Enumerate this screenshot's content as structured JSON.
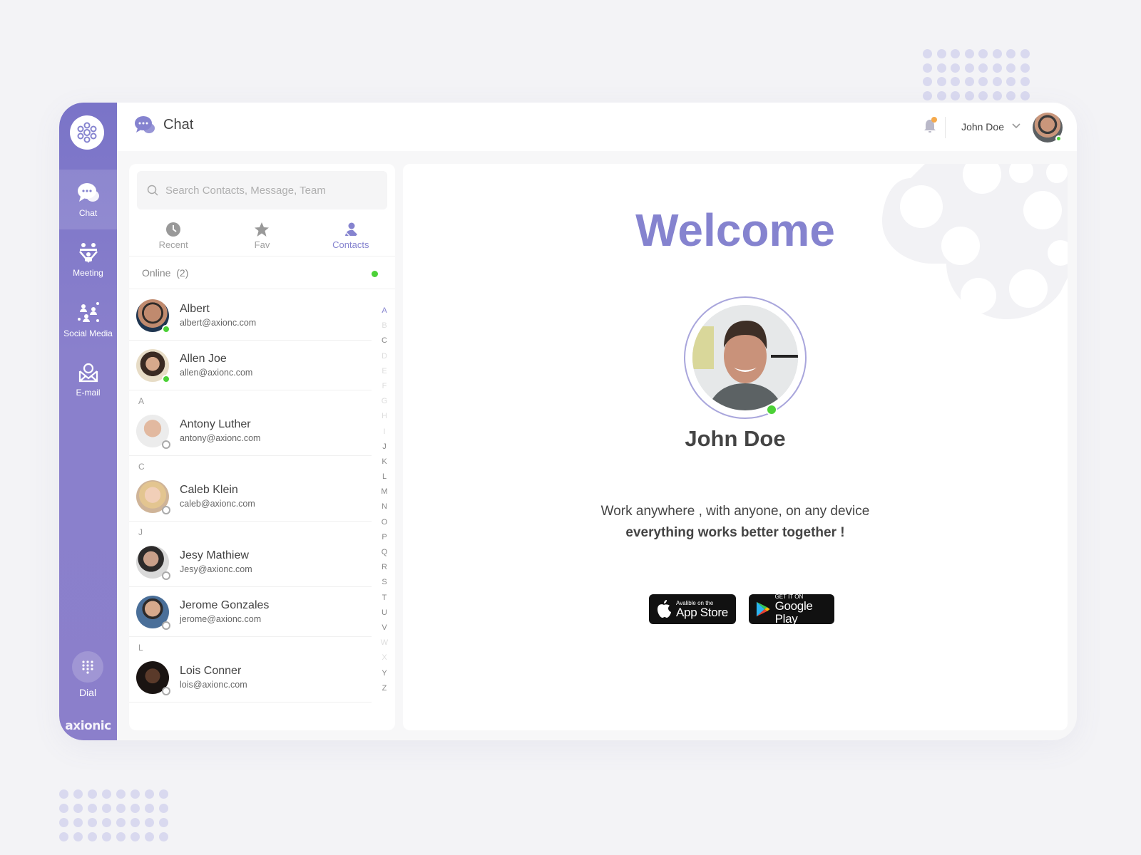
{
  "sidebar": {
    "items": [
      {
        "label": "Chat",
        "icon": "chat-bubbles-icon",
        "active": true
      },
      {
        "label": "Meeting",
        "icon": "meeting-icon",
        "active": false
      },
      {
        "label": "Social Media",
        "icon": "social-network-icon",
        "active": false
      },
      {
        "label": "E-mail",
        "icon": "email-icon",
        "active": false
      }
    ],
    "dial_label": "Dial",
    "brand": "axionic"
  },
  "header": {
    "title": "Chat",
    "user_name": "John Doe"
  },
  "contacts": {
    "search_placeholder": "Search Contacts, Message, Team",
    "tabs": [
      {
        "label": "Recent",
        "icon": "clock-icon",
        "active": false
      },
      {
        "label": "Fav",
        "icon": "star-icon",
        "active": false
      },
      {
        "label": "Contacts",
        "icon": "contacts-icon",
        "active": true
      }
    ],
    "online_label": "Online",
    "online_count": "(2)",
    "list": [
      {
        "section": "",
        "name": "Albert",
        "email": "albert@axionc.com",
        "online": true
      },
      {
        "section": "",
        "name": "Allen Joe",
        "email": "allen@axionc.com",
        "online": true
      },
      {
        "section": "A",
        "name": "Antony Luther",
        "email": "antony@axionc.com",
        "online": false
      },
      {
        "section": "C",
        "name": "Caleb Klein",
        "email": "caleb@axionc.com",
        "online": false
      },
      {
        "section": "J",
        "name": "Jesy Mathiew",
        "email": "Jesy@axionc.com",
        "online": false
      },
      {
        "section": "",
        "name": "Jerome Gonzales",
        "email": "jerome@axionc.com",
        "online": false
      },
      {
        "section": "L",
        "name": "Lois Conner",
        "email": "lois@axionc.com",
        "online": false
      }
    ],
    "alphabet": [
      "A",
      "B",
      "C",
      "D",
      "E",
      "F",
      "G",
      "H",
      "I",
      "J",
      "K",
      "L",
      "M",
      "N",
      "O",
      "P",
      "Q",
      "R",
      "S",
      "T",
      "U",
      "V",
      "W",
      "X",
      "Y",
      "Z"
    ],
    "alphabet_active": "A",
    "alphabet_faint": [
      "B",
      "D",
      "E",
      "F",
      "G",
      "H",
      "I",
      "W",
      "X"
    ]
  },
  "welcome": {
    "title": "Welcome",
    "name": "John Doe",
    "tagline_1": "Work anywhere , with anyone, on any device",
    "tagline_2": "everything works better together !",
    "app_store_small": "Avalible on the",
    "app_store_big": "App Store",
    "google_play_small": "GET IT ON",
    "google_play_big": "Google Play"
  },
  "colors": {
    "accent": "#8583cf",
    "online": "#4cd137",
    "notification": "#f5a94b"
  }
}
